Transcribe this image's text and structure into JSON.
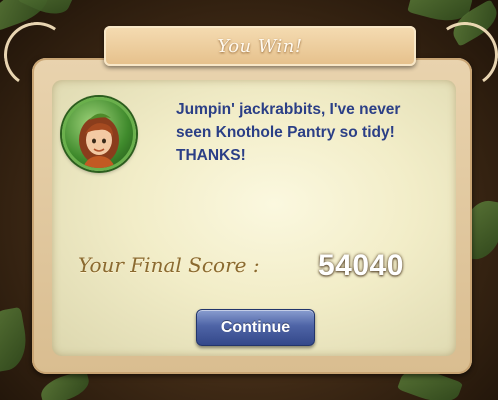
{
  "dialog": {
    "title": "You Win!",
    "message": "Jumpin' jackrabbits, I've never seen Knothole Pantry so tidy! THANKS!",
    "score_label": "Your Final Score :",
    "score_value": "54040",
    "continue_label": "Continue"
  },
  "avatar": {
    "icon": "fairy-character-portrait"
  },
  "colors": {
    "message_text": "#2b3f86",
    "score_label": "#8a6a30",
    "button": "#4e64a6",
    "panel": "#f2edc8"
  }
}
